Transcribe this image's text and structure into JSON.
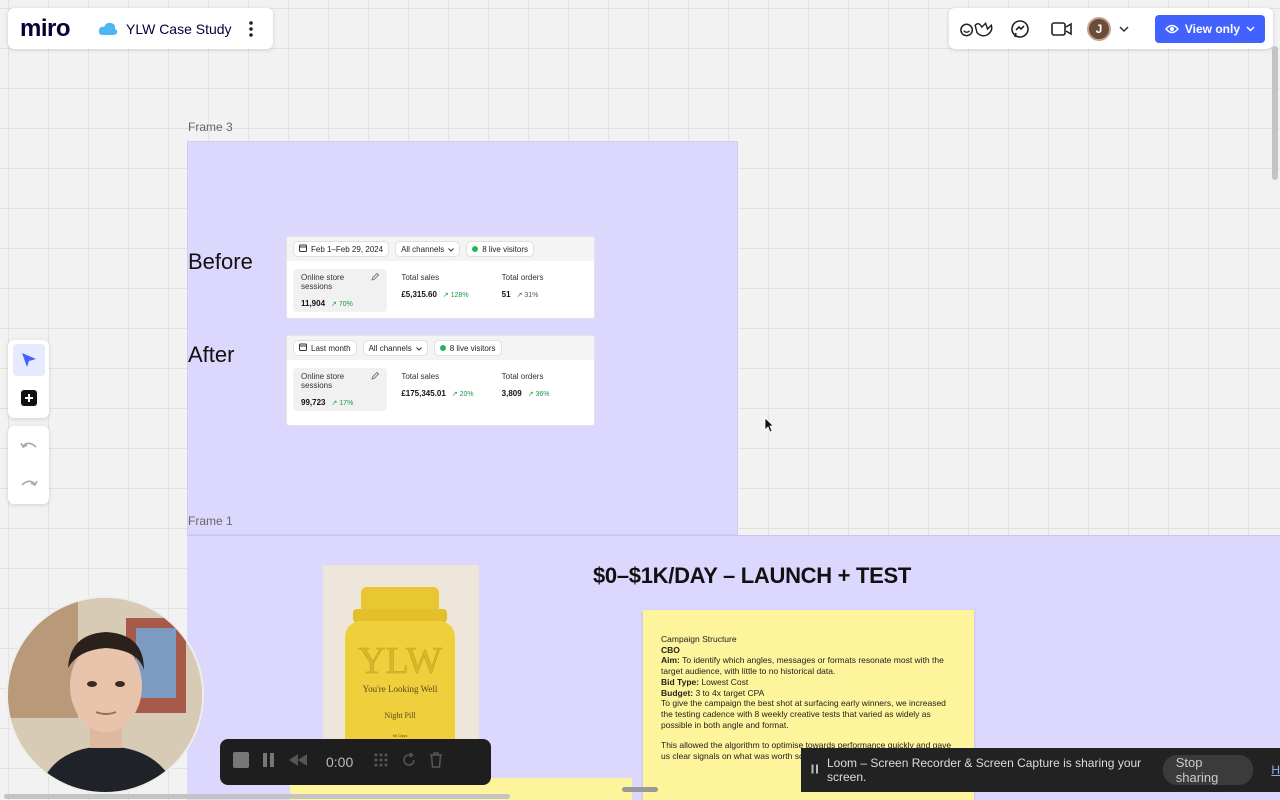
{
  "app": {
    "logo": "miro",
    "board_title": "YLW Case Study"
  },
  "header_right": {
    "view_mode_label": "View only",
    "avatar_initial": "J"
  },
  "frames": {
    "frame3": {
      "label": "Frame 3",
      "before": {
        "label": "Before",
        "date_chip": "Feb 1–Feb 29, 2024",
        "channels_chip": "All channels",
        "visitors_chip": "8 live visitors",
        "stats": [
          {
            "name": "Online store sessions",
            "value": "11,904",
            "change": "70%"
          },
          {
            "name": "Total sales",
            "value": "£5,315.60",
            "change": "128%"
          },
          {
            "name": "Total orders",
            "value": "51",
            "change": "31%"
          }
        ]
      },
      "after": {
        "label": "After",
        "date_chip": "Last month",
        "channels_chip": "All channels",
        "visitors_chip": "8 live visitors",
        "stats": [
          {
            "name": "Online store sessions",
            "value": "99,723",
            "change": "17%"
          },
          {
            "name": "Total sales",
            "value": "£175,345.01",
            "change": "20%"
          },
          {
            "name": "Total orders",
            "value": "3,809",
            "change": "36%"
          }
        ]
      }
    },
    "frame1": {
      "label": "Frame 1",
      "headline": "$0–$1K/DAY – LAUNCH + TEST",
      "product": {
        "brand": "YLW",
        "tagline": "You're Looking Well",
        "name": "Night Pill",
        "size": "90 Days"
      },
      "sticky": {
        "heading": "Campaign Structure",
        "type": "CBO",
        "aim_label": "Aim:",
        "aim_text": " To identify which angles, messages or formats resonate most with the target audience, with little to no historical data.",
        "bid_label": "Bid Type:",
        "bid_text": " Lowest Cost",
        "budget_label": "Budget:",
        "budget_text": " 3 to 4x target CPA",
        "para1": "To give the campaign the best shot at surfacing early winners, we increased the testing cadence with 8 weekly creative tests that varied as widely as possible in both angle and format.",
        "para2": "This allowed the algorithm to optimise towards performance quickly and gave us clear signals on what was worth sc"
      }
    }
  },
  "recorder": {
    "time": "0:00"
  },
  "share_banner": {
    "message": "Loom – Screen Recorder & Screen Capture is sharing your screen.",
    "stop_label": "Stop sharing",
    "hide_label": "H"
  },
  "colors": {
    "accent": "#4262ff",
    "frame_bg": "#dcd8fd",
    "sticky": "#fdf49b",
    "positive": "#1a9a4a"
  }
}
